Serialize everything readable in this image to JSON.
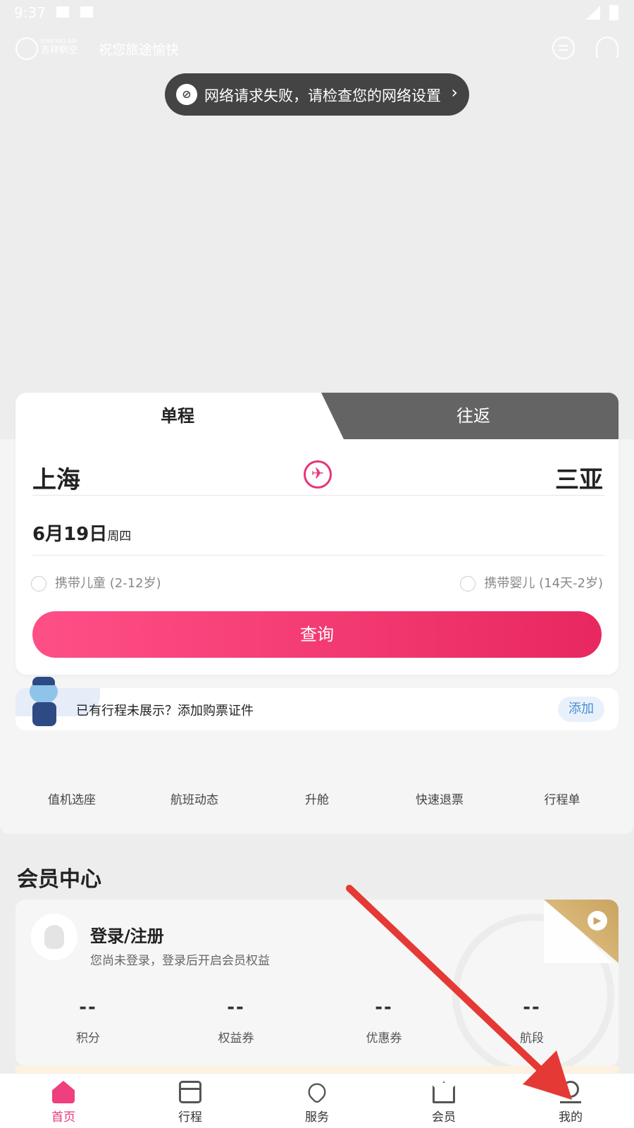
{
  "status_bar": {
    "time": "9:37"
  },
  "header": {
    "logo_line1": "JUNEYAO AIR",
    "logo_line2": "吉祥航空",
    "greeting": "祝您旅途愉快"
  },
  "toast": {
    "message": "网络请求失败，请检查您的网络设置",
    "chevron": "›"
  },
  "search": {
    "tabs": [
      {
        "label": "单程"
      },
      {
        "label": "往返"
      }
    ],
    "from_city": "上海",
    "to_city": "三亚",
    "date": "6月19日",
    "weekday": "周四",
    "option_child": "携带儿童 (2-12岁)",
    "option_infant": "携带婴儿 (14天-2岁)",
    "query_button": "查询"
  },
  "trip_prompt": {
    "text": "已有行程未展示？添加购票证件",
    "add_button": "添加"
  },
  "quick_links": [
    {
      "label": "值机选座"
    },
    {
      "label": "航班动态"
    },
    {
      "label": "升舱"
    },
    {
      "label": "快速退票"
    },
    {
      "label": "行程单"
    }
  ],
  "member_center": {
    "title": "会员中心",
    "login_title": "登录/注册",
    "login_subtitle": "您尚未登录，登录后开启会员权益",
    "stats": [
      {
        "value": "--",
        "label": "积分"
      },
      {
        "value": "--",
        "label": "权益券"
      },
      {
        "value": "--",
        "label": "优惠券"
      },
      {
        "value": "--",
        "label": "航段"
      }
    ]
  },
  "bottom_nav": [
    {
      "label": "首页",
      "icon": "home-icon",
      "active": true
    },
    {
      "label": "行程",
      "icon": "calendar-icon",
      "active": false
    },
    {
      "label": "服务",
      "icon": "heart-icon",
      "active": false
    },
    {
      "label": "会员",
      "icon": "crown-icon",
      "active": false
    },
    {
      "label": "我的",
      "icon": "person-icon",
      "active": false
    }
  ],
  "colors": {
    "accent": "#e6347a",
    "button_gradient_start": "#ff4f87",
    "button_gradient_end": "#e8285f",
    "annotation_arrow": "#e53935"
  }
}
